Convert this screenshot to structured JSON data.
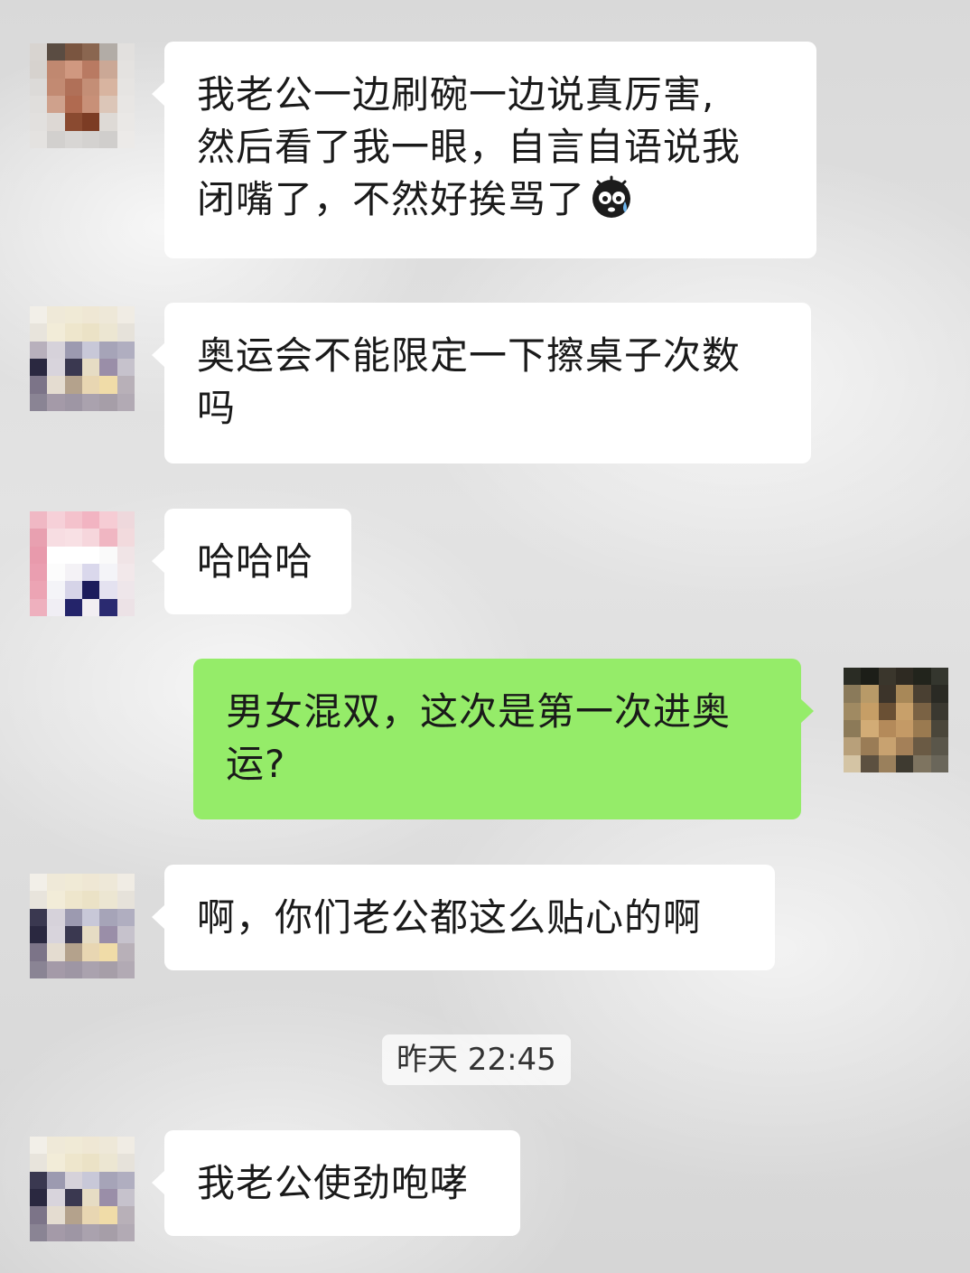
{
  "chat": {
    "messages": [
      {
        "side": "left",
        "lines": [
          "我老公一边刷碗一边说真厉害,",
          "然后看了我一眼，自言自语说我",
          "闭嘴了，不然好挨骂了"
        ],
        "emoji": "scared-sweat-emoji"
      },
      {
        "side": "left",
        "lines": [
          "奥运会不能限定一下擦桌子次数",
          "吗"
        ]
      },
      {
        "side": "left",
        "lines": [
          "哈哈哈"
        ]
      },
      {
        "side": "right",
        "lines": [
          "男女混双，这次是第一次进奥",
          "运?"
        ]
      },
      {
        "side": "left",
        "lines": [
          "啊，你们老公都这么贴心的啊"
        ]
      },
      {
        "side": "left",
        "lines": [
          "我老公使劲咆哮"
        ]
      }
    ],
    "timestamp": "昨天 22:45"
  },
  "colors": {
    "bubble_incoming": "#ffffff",
    "bubble_outgoing": "#95ec69",
    "text": "#1a1a1a",
    "background": "#dcdcdc"
  }
}
